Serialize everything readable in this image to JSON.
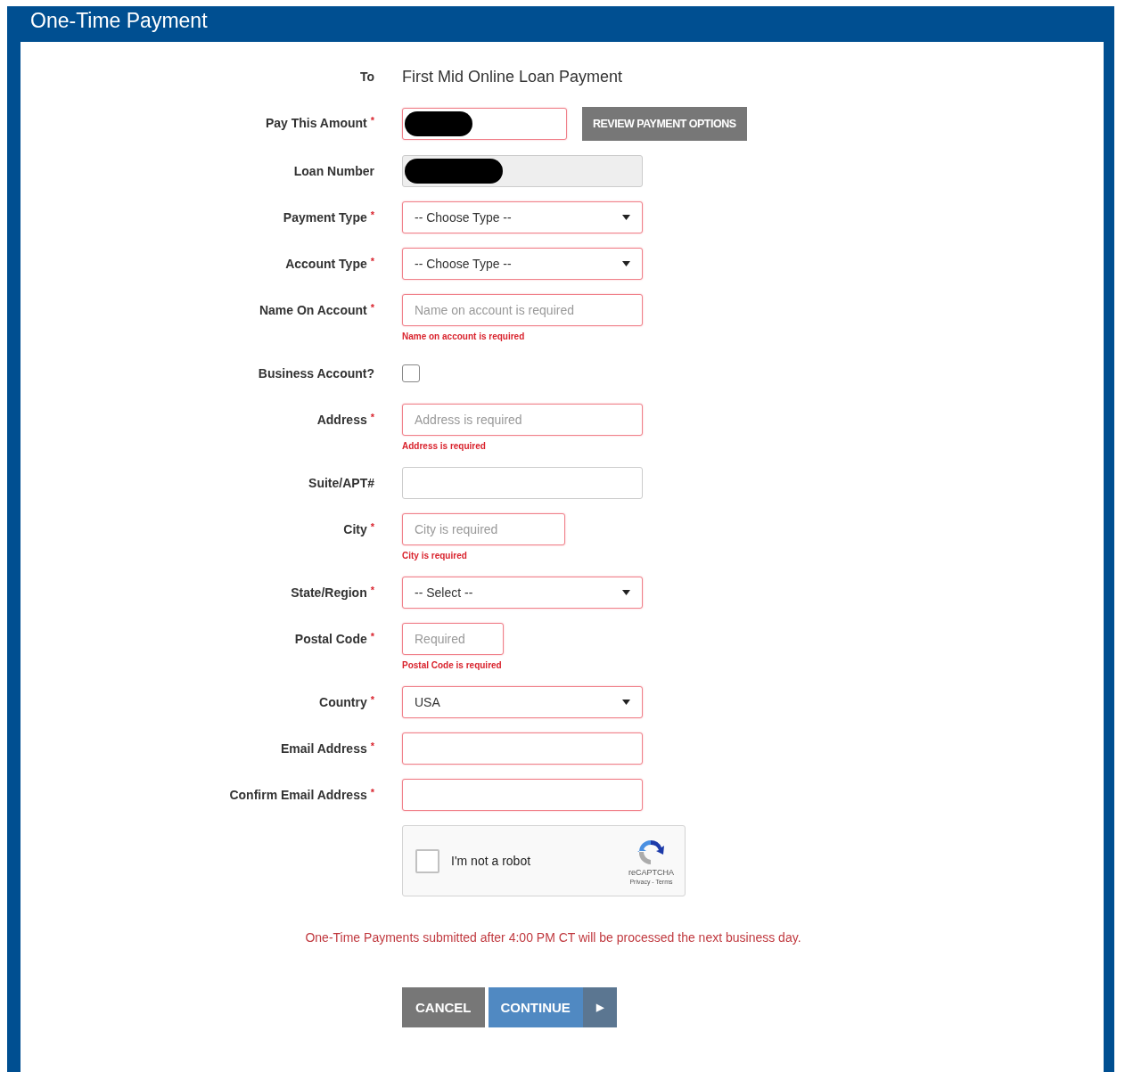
{
  "window": {
    "title": "One-Time Payment"
  },
  "fields": [
    {
      "kind": "static",
      "label": "To",
      "value": "First Mid Online Loan Payment"
    },
    {
      "kind": "redacted",
      "label": "Pay This Amount",
      "marker": "*",
      "invalid": true,
      "disabled": false,
      "button": "REVIEW PAYMENT OPTIONS"
    },
    {
      "kind": "redacted",
      "label": "Loan Number",
      "invalid": false,
      "disabled": true
    },
    {
      "kind": "select",
      "label": "Payment Type",
      "marker": "*",
      "invalid": true,
      "value": "-- Choose Type --"
    },
    {
      "kind": "select",
      "label": "Account Type",
      "marker": "*",
      "invalid": true,
      "value": "-- Choose Type --"
    },
    {
      "kind": "text",
      "label": "Name On Account",
      "marker": "*",
      "invalid": true,
      "placeholder": "Name on account is required",
      "error": "Name on account is required"
    },
    {
      "kind": "checkbox",
      "label": "Business Account?",
      "checked": false
    },
    {
      "kind": "text",
      "label": "Address",
      "marker": "*",
      "invalid": true,
      "placeholder": "Address is required",
      "error": "Address is required"
    },
    {
      "kind": "text",
      "label": "Suite/APT#",
      "invalid": false
    },
    {
      "kind": "text",
      "label": "City",
      "marker": "*",
      "invalid": true,
      "placeholder": "City is required",
      "error": "City is required"
    },
    {
      "kind": "select",
      "label": "State/Region",
      "marker": "*",
      "invalid": true,
      "value": "-- Select --"
    },
    {
      "kind": "text",
      "label": "Postal Code",
      "marker": "*",
      "invalid": true,
      "placeholder": "Required",
      "error": "Postal Code is required"
    },
    {
      "kind": "select",
      "label": "Country",
      "marker": "*",
      "invalid": true,
      "value": "USA"
    },
    {
      "kind": "text",
      "label": "Email Address",
      "marker": "*",
      "invalid": true
    },
    {
      "kind": "text",
      "label": "Confirm Email Address",
      "marker": "*",
      "invalid": true
    }
  ],
  "captcha": {
    "label": "I'm not a robot",
    "checked": false,
    "brand": "reCAPTCHA",
    "links": "Privacy - Terms"
  },
  "notice": "One-Time Payments submitted after 4:00 PM CT will be processed the next business day.",
  "buttons": [
    {
      "kind": "cancel",
      "label": "CANCEL"
    },
    {
      "kind": "continue",
      "label": "CONTINUE",
      "arrow": "▶"
    }
  ]
}
